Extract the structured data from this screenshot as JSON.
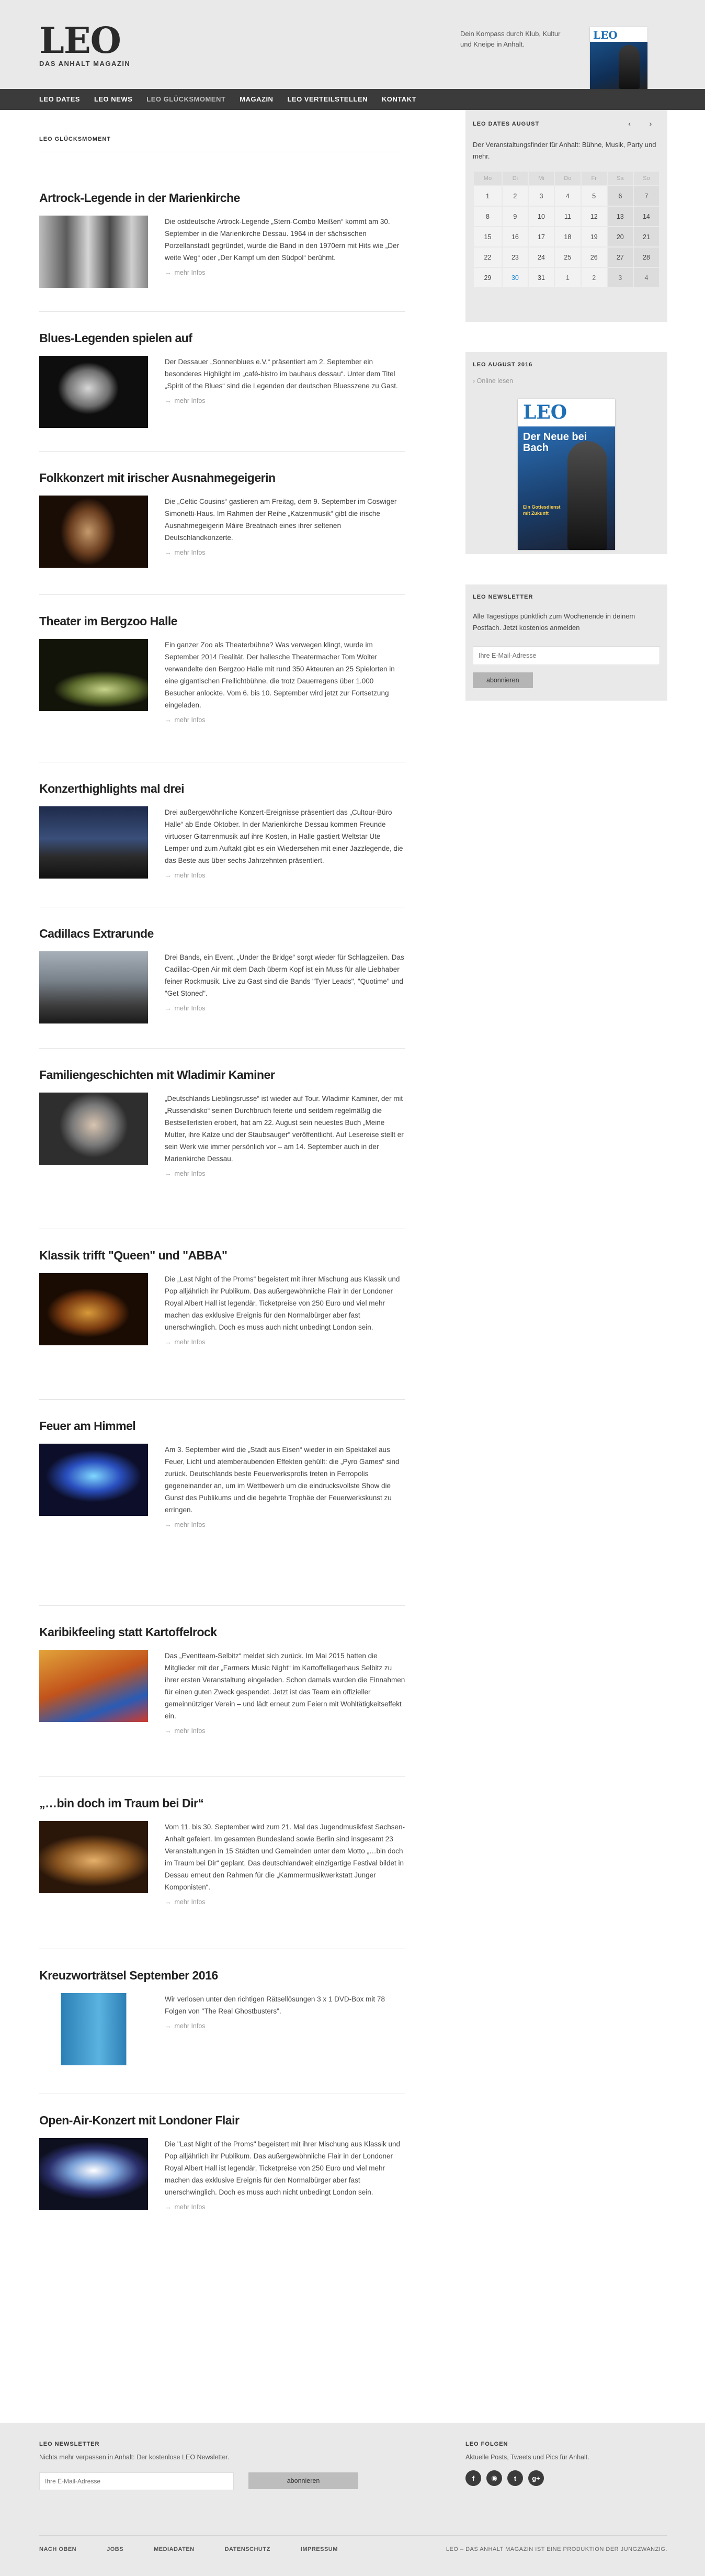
{
  "header": {
    "logo": "LEO",
    "logo_sub": "DAS ANHALT MAGAZIN",
    "tagline": "Dein Kompass durch Klub, Kultur und Kneipe in Anhalt.",
    "cover_logo": "LEO"
  },
  "nav": [
    {
      "label": "LEO Dates"
    },
    {
      "label": "LEO News"
    },
    {
      "label": "LEO Glücksmoment"
    },
    {
      "label": "Magazin"
    },
    {
      "label": "LEO Verteilstellen"
    },
    {
      "label": "Kontakt"
    }
  ],
  "main": {
    "section_title": "LEO GLÜCKSMOMENT",
    "more_label": "mehr Infos",
    "articles": [
      {
        "title": "Artrock-Legende in der Marienkirche",
        "text": "Die ostdeutsche Artrock-Legende „Stern-Combo Meißen“ kommt am 30. September in die Marienkirche Dessau. 1964 in der sächsischen Porzellanstadt gegründet, wurde die Band in den 1970ern mit Hits wie „Der weite Weg“ oder „Der Kampf um den Südpol“ berühmt."
      },
      {
        "title": "Blues-Legenden spielen auf",
        "text": "Der Dessauer „Sonnenblues e.V.“ präsentiert am 2. September ein besonderes Highlight im „café-bistro im bauhaus dessau“. Unter dem Titel „Spirit of the Blues“ sind die Legenden der deutschen Bluesszene zu Gast."
      },
      {
        "title": "Folkkonzert mit irischer Ausnahmegeigerin",
        "text": "Die „Celtic Cousins“ gastieren am Freitag, dem 9. September im Coswiger Simonetti-Haus. Im Rahmen der Reihe „Katzenmusik“ gibt die irische Ausnahmegeigerin Máire Breatnach eines ihrer seltenen Deutschlandkonzerte."
      },
      {
        "title": "Theater im Bergzoo Halle",
        "text": "Ein ganzer Zoo als Theaterbühne? Was verwegen klingt, wurde im September 2014 Realität. Der hallesche Theatermacher Tom Wolter verwandelte den Bergzoo Halle mit rund 350 Akteuren an 25 Spielorten in eine gigantischen Freilichtbühne, die trotz Dauerregens über 1.000 Besucher anlockte. Vom 6. bis 10. September wird jetzt zur Fortsetzung eingeladen."
      },
      {
        "title": "Konzerthighlights mal drei",
        "text": "Drei außergewöhnliche Konzert-Ereignisse präsentiert das „Cultour-Büro Halle“ ab Ende Oktober. In der Marienkirche Dessau kommen Freunde virtuoser Gitarrenmusik auf ihre Kosten, in Halle gastiert Weltstar Ute Lemper und zum Auftakt gibt es ein Wiedersehen mit einer Jazzlegende, die das Beste aus über sechs Jahrzehnten präsentiert."
      },
      {
        "title": "Cadillacs Extrarunde",
        "text": "Drei Bands, ein Event, „Under the Bridge“ sorgt wieder für Schlagzeilen. Das Cadillac-Open Air mit dem Dach überm Kopf ist ein Muss für alle Liebhaber feiner Rockmusik. Live zu Gast sind die Bands \"Tyler Leads\", \"Quotime\" und \"Get Stoned\"."
      },
      {
        "title": "Familiengeschichten mit Wladimir Kaminer",
        "text": "„Deutschlands Lieblingsrusse“ ist wieder auf Tour. Wladimir Kaminer, der mit „Russendisko“ seinen Durchbruch feierte und seitdem regelmäßig die Bestsellerlisten erobert, hat am 22. August sein neuestes Buch „Meine Mutter, ihre Katze und der Staubsauger“ veröffentlicht. Auf Lesereise stellt er sein Werk wie immer persönlich vor – am 14. September auch in der Marienkirche Dessau."
      },
      {
        "title": "Klassik trifft \"Queen\" und \"ABBA\"",
        "text": "Die „Last Night of the Proms“ begeistert mit ihrer Mischung aus Klassik und Pop alljährlich ihr Publikum. Das außergewöhnliche Flair in der Londoner Royal Albert Hall ist legendär, Ticketpreise von 250 Euro und viel mehr machen das exklusive Ereignis für den Normalbürger aber fast unerschwinglich. Doch es muss auch nicht unbedingt London sein."
      },
      {
        "title": "Feuer am Himmel",
        "text": "Am 3. September wird die „Stadt aus Eisen“ wieder in ein Spektakel aus Feuer, Licht und atemberaubenden Effekten gehüllt: die „Pyro Games“ sind zurück. Deutschlands beste Feuerwerksprofis treten in Ferropolis gegeneinander an, um im Wettbewerb um die eindrucksvollste Show die Gunst des Publikums und die begehrte Trophäe der Feuerwerkskunst zu erringen."
      },
      {
        "title": "Karibikfeeling statt Kartoffelrock",
        "text": "Das „Eventteam-Selbitz“ meldet sich zurück. Im Mai 2015 hatten die Mitglieder mit der „Farmers Music Night“ im Kartoffellagerhaus Selbitz zu ihrer ersten Veranstaltung eingeladen. Schon damals wurden die Einnahmen für einen guten Zweck gespendet. Jetzt ist das Team ein offizieller gemeinnütziger Verein – und lädt erneut zum Feiern mit Wohltätigkeitseffekt ein."
      },
      {
        "title": "„…bin doch im Traum bei Dir“",
        "text": "Vom 11. bis 30. September wird zum 21. Mal das Jugendmusikfest Sachsen-Anhalt gefeiert. Im gesamten Bundesland sowie Berlin sind insgesamt 23 Veranstaltungen in 15 Städten und Gemeinden unter dem Motto „…bin doch im Traum bei Dir“ geplant. Das deutschlandweit einzigartige Festival bildet in Dessau erneut den Rahmen für die „Kammermusikwerkstatt Junger Komponisten“."
      },
      {
        "title": "Kreuzworträtsel September 2016",
        "text": "Wir verlosen unter den richtigen Rätsellösungen 3 x 1 DVD-Box mit 78 Folgen von \"The Real Ghostbusters\"."
      },
      {
        "title": "Open-Air-Konzert mit Londoner Flair",
        "text": "Die \"Last Night of the Proms\" begeistert mit ihrer Mischung aus Klassik und Pop alljährlich ihr Publikum. Das außergewöhnliche Flair in der Londoner Royal Albert Hall ist legendär, Ticketpreise von 250 Euro und viel mehr machen das exklusive Ereignis für den Normalbürger aber fast unerschwinglich. Doch es muss auch nicht unbedingt London sein."
      }
    ]
  },
  "sidebar": {
    "calendar": {
      "title": "LEO DATES AUGUST",
      "prev": "‹",
      "next": "›",
      "text": "Der Veranstaltungsfinder für Anhalt: Bühne, Musik, Party und mehr.",
      "weekdays": [
        "Mo",
        "Di",
        "Mi",
        "Do",
        "Fr",
        "Sa",
        "So"
      ],
      "weeks": [
        [
          "1",
          "2",
          "3",
          "4",
          "5",
          "6",
          "7"
        ],
        [
          "8",
          "9",
          "10",
          "11",
          "12",
          "13",
          "14"
        ],
        [
          "15",
          "16",
          "17",
          "18",
          "19",
          "20",
          "21"
        ],
        [
          "22",
          "23",
          "24",
          "25",
          "26",
          "27",
          "28"
        ],
        [
          "29",
          "30",
          "31",
          "1",
          "2",
          "3",
          "4"
        ]
      ],
      "today": "30"
    },
    "magazine": {
      "title": "LEO AUGUST 2016",
      "online_label": "Online lesen",
      "cover_logo": "LEO",
      "cover_headline": "Der Neue bei Bach",
      "cover_sub": "Ein Gottesdienst mit Zukunft"
    },
    "newsletter": {
      "title": "LEO NEWSLETTER",
      "text": "Alle Tagestipps pünktlich zum Wochenende in deinem Postfach. Jetzt kostenlos anmelden",
      "placeholder": "Ihre E-Mail-Adresse",
      "button": "abonnieren"
    }
  },
  "footer": {
    "newsletter_title": "LEO NEWSLETTER",
    "newsletter_text": "Nichts mehr verpassen in Anhalt: Der kostenlose LEO Newsletter.",
    "placeholder": "Ihre E-Mail-Adresse",
    "button": "abonnieren",
    "follow_title": "LEO FOLGEN",
    "follow_text": "Aktuelle Posts, Tweets und Pics für Anhalt.",
    "socials": [
      {
        "glyph": "f",
        "icon": "facebook-icon"
      },
      {
        "glyph": "◉",
        "icon": "instagram-icon"
      },
      {
        "glyph": "t",
        "icon": "twitter-icon"
      },
      {
        "glyph": "g+",
        "icon": "google-plus-icon"
      }
    ],
    "links": [
      "NACH OBEN",
      "JOBS",
      "MEDIADATEN",
      "DATENSCHUTZ",
      "IMPRESSUM"
    ],
    "copyright": "LEO – DAS ANHALT MAGAZIN IST EINE PRODUKTION DER JUNGZWANZIG."
  },
  "colors": {
    "nav_bg": "#3b3b3b",
    "panel_bg": "#e9e9e9",
    "accent_link": "#1e88d8"
  }
}
